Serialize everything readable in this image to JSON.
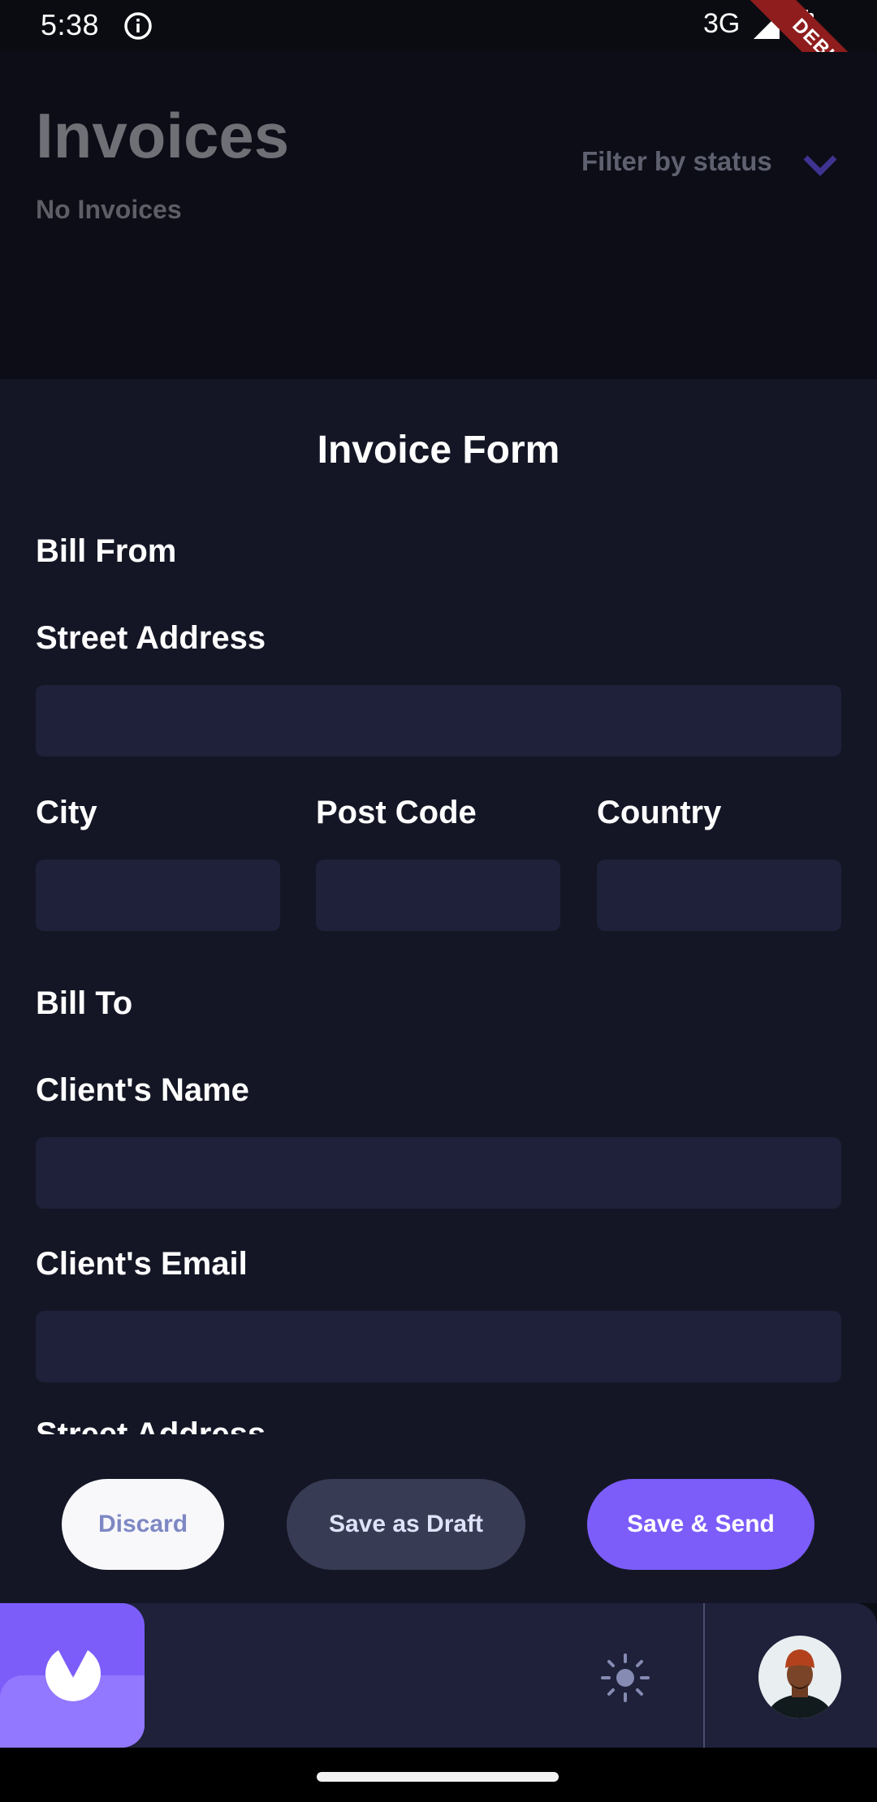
{
  "status_bar": {
    "time": "5:38",
    "network": "3G",
    "debug_banner": "DEBUG"
  },
  "page": {
    "title": "Invoices",
    "subtitle": "No Invoices",
    "filter_label": "Filter by status"
  },
  "form": {
    "title": "Invoice Form",
    "bill_from": {
      "section_title": "Bill From",
      "street_label": "Street Address",
      "street_value": "",
      "city_label": "City",
      "city_value": "",
      "post_code_label": "Post Code",
      "post_code_value": "",
      "country_label": "Country",
      "country_value": ""
    },
    "bill_to": {
      "section_title": "Bill To",
      "client_name_label": "Client's Name",
      "client_name_value": "",
      "client_email_label": "Client's Email",
      "client_email_value": "",
      "street_label": "Street Address"
    }
  },
  "actions": {
    "discard": "Discard",
    "save_draft": "Save as Draft",
    "save_send": "Save & Send"
  },
  "app_bar": {
    "logo_icon": "app-logo-icon",
    "theme_icon": "sun-icon",
    "avatar_icon": "user-avatar"
  },
  "colors": {
    "accent": "#7c5dfa",
    "accent_light": "#9277ff",
    "sheet_bg": "#141625",
    "input_bg": "#1e2139",
    "draft_bg": "#373b53",
    "discard_text": "#7e88c3"
  }
}
